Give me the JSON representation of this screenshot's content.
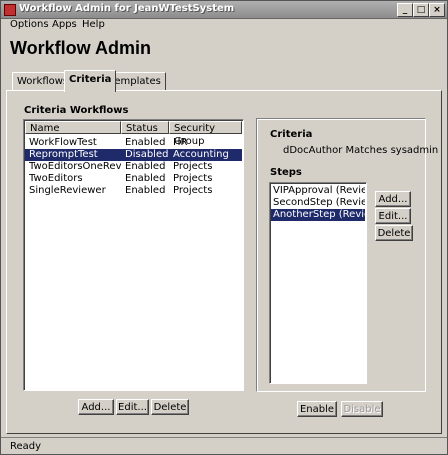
{
  "window": {
    "title": "Workflow Admin for JeanWTestSystem"
  },
  "menu": [
    "Options",
    "Apps",
    "Help"
  ],
  "heading": "Workflow Admin",
  "tabs": [
    {
      "label": "Workflows",
      "active": false
    },
    {
      "label": "Criteria",
      "active": true
    },
    {
      "label": "Templates",
      "active": false
    }
  ],
  "criteria_workflows": {
    "label": "Criteria Workflows",
    "columns": [
      "Name",
      "Status",
      "Security Group"
    ],
    "rows": [
      {
        "name": "WorkFlowTest",
        "status": "Enabled",
        "group": "HR",
        "selected": false
      },
      {
        "name": "RepromptTest",
        "status": "Disabled",
        "group": "Accounting",
        "selected": true
      },
      {
        "name": "TwoEditorsOneRevi...",
        "status": "Enabled",
        "group": "Projects",
        "selected": false
      },
      {
        "name": "TwoEditors",
        "status": "Enabled",
        "group": "Projects",
        "selected": false
      },
      {
        "name": "SingleReviewer",
        "status": "Enabled",
        "group": "Projects",
        "selected": false
      }
    ],
    "buttons": {
      "add": "Add...",
      "edit": "Edit...",
      "delete": "Delete"
    }
  },
  "criteria": {
    "label": "Criteria",
    "value": "dDocAuthor Matches sysadmin"
  },
  "steps": {
    "label": "Steps",
    "items": [
      {
        "text": "VIPApproval (Review)",
        "selected": false
      },
      {
        "text": "SecondStep (Review)",
        "selected": false
      },
      {
        "text": "AnotherStep (Review/N",
        "selected": true
      }
    ],
    "buttons": {
      "add": "Add...",
      "edit": "Edit...",
      "delete": "Delete"
    }
  },
  "enable_button": "Enable",
  "disable_button": "Disable",
  "status": "Ready",
  "colors": {
    "selection": "#1f2a6b",
    "background": "#d4d0c8"
  }
}
